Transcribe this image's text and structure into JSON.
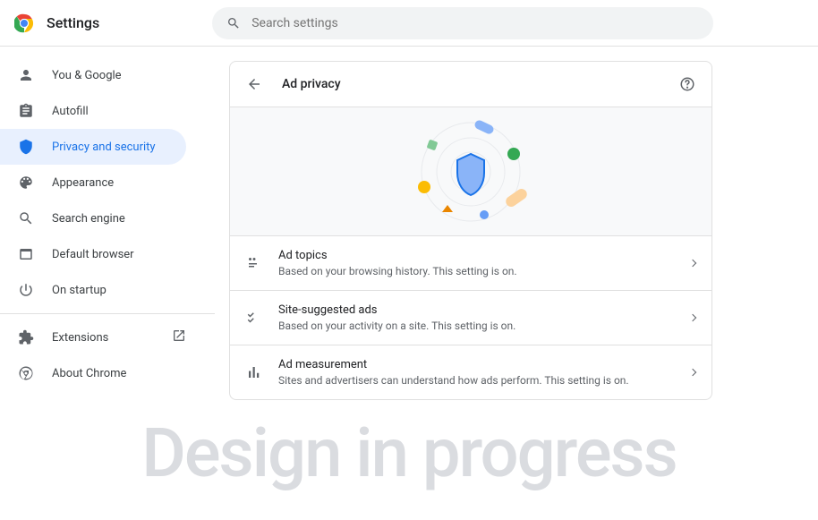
{
  "header": {
    "title": "Settings",
    "search_placeholder": "Search settings"
  },
  "sidebar": {
    "items": [
      {
        "label": "You & Google"
      },
      {
        "label": "Autofill"
      },
      {
        "label": "Privacy and security"
      },
      {
        "label": "Appearance"
      },
      {
        "label": "Search engine"
      },
      {
        "label": "Default browser"
      },
      {
        "label": "On startup"
      }
    ],
    "extensions_label": "Extensions",
    "about_label": "About Chrome"
  },
  "page": {
    "title": "Ad privacy",
    "rows": [
      {
        "title": "Ad topics",
        "desc": "Based on your browsing history. This setting is on."
      },
      {
        "title": "Site-suggested ads",
        "desc": "Based on your activity on a site. This setting is on."
      },
      {
        "title": "Ad measurement",
        "desc": "Sites and advertisers can understand how ads perform. This setting is on."
      }
    ]
  },
  "watermark": "Design in progress"
}
